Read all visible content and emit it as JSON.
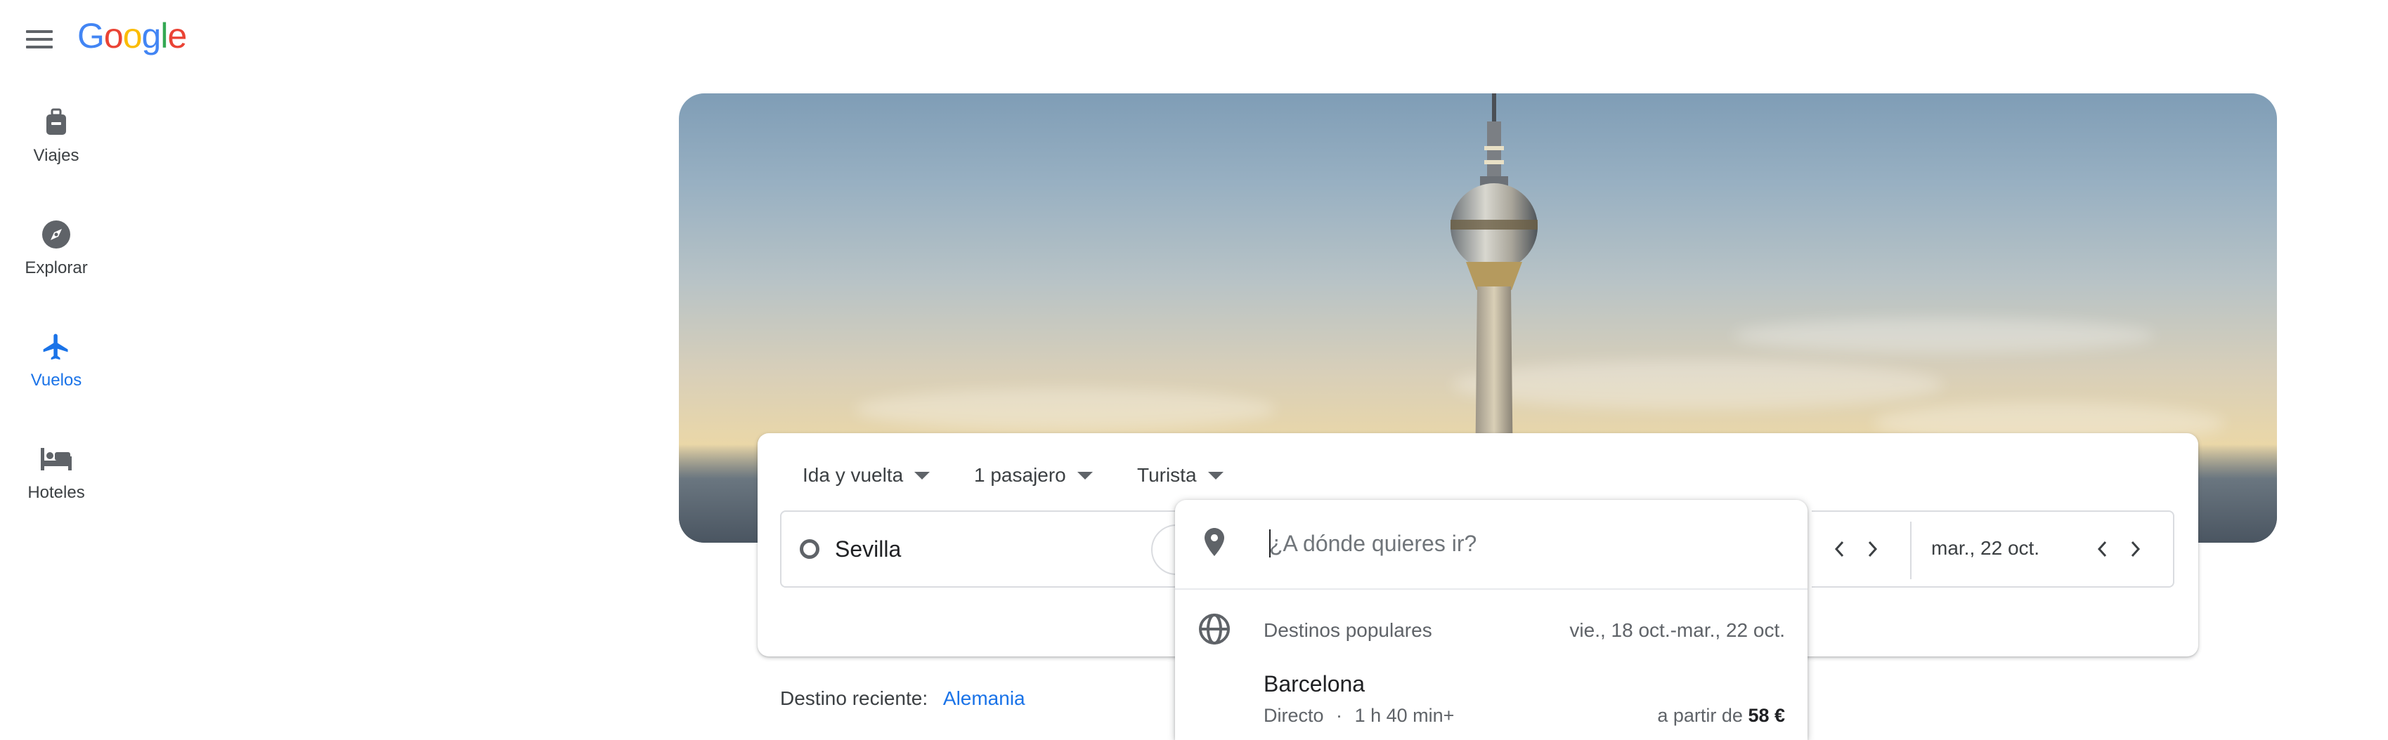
{
  "header": {
    "logo_parts": [
      "G",
      "o",
      "o",
      "g",
      "l",
      "e"
    ]
  },
  "nav": {
    "items": [
      {
        "label": "Viajes",
        "icon": "suitcase-icon"
      },
      {
        "label": "Explorar",
        "icon": "compass-icon"
      },
      {
        "label": "Vuelos",
        "icon": "airplane-icon",
        "active": true
      },
      {
        "label": "Hoteles",
        "icon": "bed-icon"
      }
    ]
  },
  "search": {
    "trip_type": "Ida y vuelta",
    "passengers": "1 pasajero",
    "cabin_class": "Turista",
    "origin": "Sevilla",
    "return_date": "mar., 22 oct."
  },
  "dropdown": {
    "placeholder": "¿A dónde quieres ir?",
    "popular_label": "Destinos populares",
    "popular_dates": "vie., 18 oct.-mar., 22 oct.",
    "destinations": [
      {
        "name": "Barcelona",
        "stops": "Directo",
        "duration": "1 h 40 min+",
        "price_prefix": "a partir de",
        "price": "58 €"
      }
    ]
  },
  "recent": {
    "label": "Destino reciente:",
    "link": "Alemania"
  },
  "colors": {
    "accent": "#1a73e8",
    "text": "#3c4043"
  }
}
